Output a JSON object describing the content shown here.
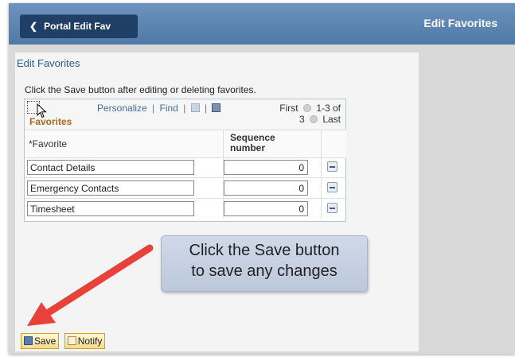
{
  "header": {
    "back_button_label": "Portal Edit Fav",
    "page_title": "Edit Favorites"
  },
  "panel": {
    "heading": "Edit Favorites",
    "instructions": "Click the Save button after editing or deleting favorites."
  },
  "grid": {
    "caption": "Favorites",
    "tools": {
      "personalize": "Personalize",
      "find": "Find"
    },
    "nav": {
      "first": "First",
      "range": "1-3 of",
      "total": "3",
      "last": "Last"
    },
    "columns": {
      "favorite": "*Favorite",
      "sequence": "Sequence number"
    },
    "rows": [
      {
        "favorite": "Contact Details",
        "sequence": "0"
      },
      {
        "favorite": "Emergency Contacts",
        "sequence": "0"
      },
      {
        "favorite": "Timesheet",
        "sequence": "0"
      }
    ]
  },
  "callout": {
    "line1": "Click the Save button",
    "line2": "to save any changes"
  },
  "actions": {
    "save_label": "Save",
    "notify_label": "Notify"
  },
  "colors": {
    "topbar": "#5a83af",
    "back_button": "#1f3f66",
    "arrow": "#e8413a",
    "caption": "#a8681c"
  }
}
